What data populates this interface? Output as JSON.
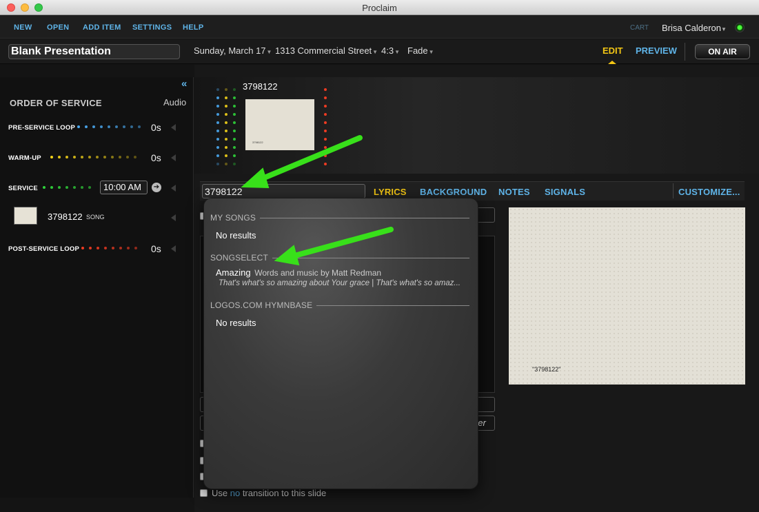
{
  "window": {
    "title": "Proclaim"
  },
  "menu": {
    "items": [
      "NEW",
      "OPEN",
      "ADD ITEM",
      "SETTINGS",
      "HELP"
    ],
    "cart": "CART",
    "user": "Brisa Calderon"
  },
  "toolbar": {
    "presentation_title": "Blank Presentation",
    "date": "Sunday, March 17",
    "location": "1313 Commercial Street",
    "aspect": "4:3",
    "transition": "Fade",
    "edit_tab": "EDIT",
    "preview_tab": "PREVIEW",
    "on_air": "ON AIR"
  },
  "sidebar": {
    "collapse_icon": "«",
    "title": "ORDER OF SERVICE",
    "audio_label": "Audio",
    "segments": [
      {
        "label": "PRE-SERVICE LOOP",
        "duration": "0s",
        "color": "#4aa8f0"
      },
      {
        "label": "WARM-UP",
        "duration": "0s",
        "color": "#f2d21a"
      },
      {
        "label": "SERVICE",
        "start_time": "10:00 AM",
        "color": "#2fd23a"
      },
      {
        "label": "POST-SERVICE LOOP",
        "duration": "0s",
        "color": "#ee3b22"
      }
    ],
    "song_item": {
      "number": "3798122",
      "type": "SONG"
    }
  },
  "slides": {
    "label": "3798122",
    "thumb_caption": "3798122"
  },
  "edit_bar": {
    "search_value": "3798122",
    "tabs": [
      "LYRICS",
      "BACKGROUND",
      "NOTES",
      "SIGNALS"
    ],
    "customize": "CUSTOMIZE..."
  },
  "options": {
    "no_transition_prefix": "Use ",
    "no_transition_hl": "no",
    "no_transition_suffix": " transition to this slide",
    "partial_text": "ber"
  },
  "preview": {
    "caption": "\"3798122\""
  },
  "popover": {
    "my_songs": {
      "heading": "MY SONGS",
      "result": "No results"
    },
    "songselect": {
      "heading": "SONGSELECT",
      "song_title": "Amazing",
      "song_credit": "Words and music by Matt Redman",
      "song_lyric": "That's what's so amazing about Your grace | That's what's so amaz..."
    },
    "logos": {
      "heading": "LOGOS.COM HYMNBASE",
      "result": "No results"
    }
  }
}
